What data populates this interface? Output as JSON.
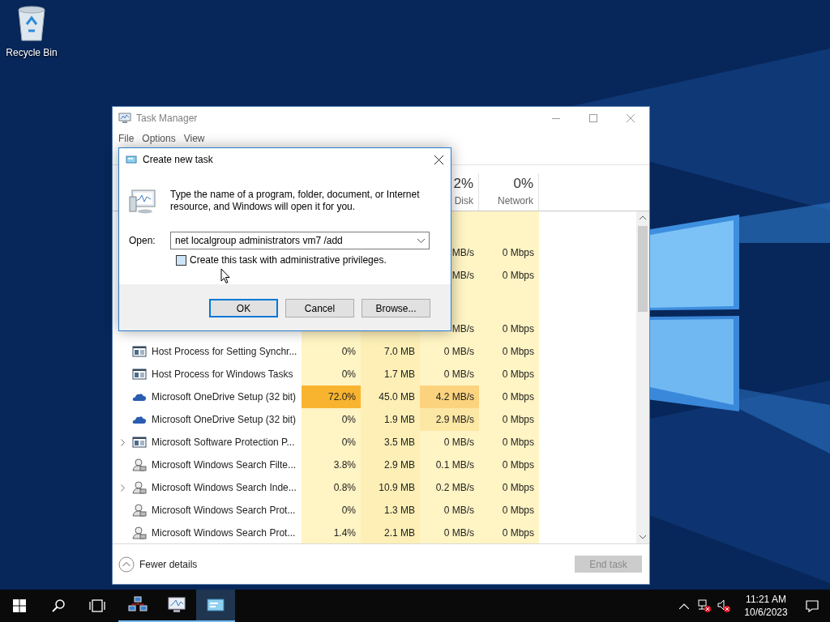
{
  "desktop": {
    "icons": [
      {
        "label": "Recycle Bin"
      }
    ]
  },
  "task_manager": {
    "title": "Task Manager",
    "menu": [
      "File",
      "Options",
      "View"
    ],
    "columns": [
      {},
      {},
      {
        "percent": "2%",
        "label": "Disk"
      },
      {
        "percent": "0%",
        "label": "Network"
      }
    ],
    "rows": [
      {
        "kind": "partial",
        "cells": [
          {},
          {},
          {
            "text": "MB/s"
          },
          {
            "text": "0 Mbps"
          }
        ]
      },
      {
        "kind": "partial",
        "cells": [
          {},
          {},
          {
            "text": "MB/s"
          },
          {
            "text": "0 Mbps"
          }
        ]
      },
      {
        "kind": "covered",
        "cells": [
          {},
          {},
          {
            "text": "MB/s"
          },
          {
            "text": "0 Mbps"
          }
        ]
      },
      {
        "kind": "app",
        "expandable": false,
        "name": "Host Process for Setting Synchr...",
        "cells": [
          {
            "text": "0%"
          },
          {
            "text": "7.0 MB"
          },
          {
            "text": "0 MB/s"
          },
          {
            "text": "0 Mbps"
          }
        ]
      },
      {
        "kind": "app",
        "expandable": false,
        "name": "Host Process for Windows Tasks",
        "cells": [
          {
            "text": "0%"
          },
          {
            "text": "1.7 MB"
          },
          {
            "text": "0 MB/s"
          },
          {
            "text": "0 Mbps"
          }
        ]
      },
      {
        "kind": "cloud",
        "expandable": false,
        "name": "Microsoft OneDrive Setup (32 bit)",
        "cells": [
          {
            "text": "72.0%",
            "color": "#f9b42f"
          },
          {
            "text": "45.0 MB"
          },
          {
            "text": "4.2 MB/s",
            "color": "#fbd37e"
          },
          {
            "text": "0 Mbps"
          }
        ]
      },
      {
        "kind": "cloud",
        "expandable": false,
        "name": "Microsoft OneDrive Setup (32 bit)",
        "cells": [
          {
            "text": "0%"
          },
          {
            "text": "1.9 MB"
          },
          {
            "text": "2.9 MB/s",
            "color": "#fde7a4"
          },
          {
            "text": "0 Mbps"
          }
        ]
      },
      {
        "kind": "app",
        "expandable": true,
        "name": "Microsoft Software Protection P...",
        "cells": [
          {
            "text": "0%"
          },
          {
            "text": "3.5 MB"
          },
          {
            "text": "0 MB/s"
          },
          {
            "text": "0 Mbps"
          }
        ]
      },
      {
        "kind": "service",
        "expandable": false,
        "name": "Microsoft Windows Search Filte...",
        "cells": [
          {
            "text": "3.8%"
          },
          {
            "text": "2.9 MB"
          },
          {
            "text": "0.1 MB/s"
          },
          {
            "text": "0 Mbps"
          }
        ]
      },
      {
        "kind": "service",
        "expandable": true,
        "name": "Microsoft Windows Search Inde...",
        "cells": [
          {
            "text": "0.8%"
          },
          {
            "text": "10.9 MB"
          },
          {
            "text": "0.2 MB/s"
          },
          {
            "text": "0 Mbps"
          }
        ]
      },
      {
        "kind": "service",
        "expandable": false,
        "name": "Microsoft Windows Search Prot...",
        "cells": [
          {
            "text": "0%"
          },
          {
            "text": "1.3 MB"
          },
          {
            "text": "0 MB/s"
          },
          {
            "text": "0 Mbps"
          }
        ]
      },
      {
        "kind": "service",
        "expandable": false,
        "name": "Microsoft Windows Search Prot...",
        "cells": [
          {
            "text": "1.4%"
          },
          {
            "text": "2.1 MB"
          },
          {
            "text": "0 MB/s"
          },
          {
            "text": "0 Mbps"
          }
        ]
      }
    ],
    "footer": {
      "toggle": "Fewer details",
      "end_task": {
        "label": "End task",
        "disabled": true
      }
    }
  },
  "dialog": {
    "title": "Create new task",
    "message": "Type the name of a program, folder, document, or Internet resource, and Windows will open it for you.",
    "open_label": "Open:",
    "command": "net localgroup administrators vm7 /add",
    "admin_checkbox": {
      "label": "Create this task with administrative privileges.",
      "checked": false
    },
    "buttons": [
      {
        "label": "OK",
        "default": true
      },
      {
        "label": "Cancel",
        "default": false
      },
      {
        "label": "Browse...",
        "default": false
      }
    ]
  },
  "taskbar": {
    "apps": [
      {
        "kind": "network",
        "running": true,
        "active": false
      },
      {
        "kind": "monitor",
        "running": true,
        "active": false
      },
      {
        "kind": "run",
        "running": true,
        "active": true
      }
    ],
    "clock": {
      "time": "11:21 AM",
      "date": "10/6/2023"
    }
  }
}
